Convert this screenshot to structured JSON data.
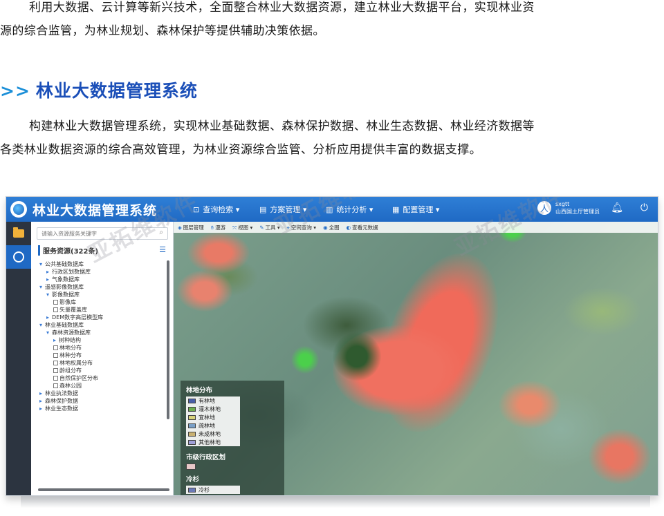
{
  "article": {
    "para1_line1": "利用大数据、云计算等新兴技术，全面整合林业大数据资源，建立林业大数据平台，实现林业资",
    "para1_line2": "源的综合监管，为林业规划、森林保护等提供辅助决策依据。",
    "heading_chevron": ">>",
    "heading": "林业大数据管理系统",
    "para2_line1": "构建林业大数据管理系统，实现林业基础数据、森林保护数据、林业生态数据、林业经济数据等",
    "para2_line2": "各类林业数据资源的综合高效管理，为林业资源综合监管、分析应用提供丰富的数据支撑。"
  },
  "watermark": "亚拓维软件",
  "app": {
    "title": "林业大数据管理系统",
    "menu": [
      {
        "icon": "search-icon",
        "label": "查询检索 ▾"
      },
      {
        "icon": "document-icon",
        "label": "方案管理 ▾"
      },
      {
        "icon": "chart-icon",
        "label": "统计分析 ▾"
      },
      {
        "icon": "settings-icon",
        "label": "配置管理 ▾"
      }
    ],
    "user": {
      "name": "sxgtt",
      "role": "山西国土厅管理员",
      "avatar": "人"
    },
    "bell_icon": "bell-icon",
    "logout_icon": "logout-icon"
  },
  "panel": {
    "search_placeholder": "请输入资源服务关键字",
    "resource_title": "服务资源(322条)",
    "tree": [
      {
        "level": 0,
        "toggle": "▾",
        "check": false,
        "label": "公共基础数据库"
      },
      {
        "level": 1,
        "toggle": "▸",
        "check": false,
        "label": "行政区划数据库"
      },
      {
        "level": 1,
        "toggle": "▸",
        "check": false,
        "label": "气象数据库"
      },
      {
        "level": 0,
        "toggle": "▾",
        "check": false,
        "label": "遥感影像数据库"
      },
      {
        "level": 1,
        "toggle": "▾",
        "check": false,
        "label": "影像数据库"
      },
      {
        "level": 2,
        "toggle": "",
        "check": true,
        "label": "影像库"
      },
      {
        "level": 2,
        "toggle": "",
        "check": true,
        "label": "矢量覆盖库"
      },
      {
        "level": 1,
        "toggle": "▸",
        "check": false,
        "label": "DEM数字高层模型库"
      },
      {
        "level": 0,
        "toggle": "▾",
        "check": false,
        "label": "林业基础数据库"
      },
      {
        "level": 1,
        "toggle": "▾",
        "check": false,
        "label": "森林资源数据库"
      },
      {
        "level": 2,
        "toggle": "▸",
        "check": false,
        "label": "树种结构"
      },
      {
        "level": 2,
        "toggle": "",
        "check": true,
        "label": "林地分布"
      },
      {
        "level": 2,
        "toggle": "",
        "check": true,
        "label": "林种分布"
      },
      {
        "level": 2,
        "toggle": "",
        "check": true,
        "label": "林地权属分布"
      },
      {
        "level": 2,
        "toggle": "",
        "check": true,
        "label": "龄组分布"
      },
      {
        "level": 2,
        "toggle": "",
        "check": true,
        "label": "自然保护区分布"
      },
      {
        "level": 2,
        "toggle": "",
        "check": true,
        "label": "森林公园"
      },
      {
        "level": 0,
        "toggle": "▸",
        "check": false,
        "label": "林业执法数据"
      },
      {
        "level": 0,
        "toggle": "▸",
        "check": false,
        "label": "森林保护数据"
      },
      {
        "level": 0,
        "toggle": "▸",
        "check": false,
        "label": "林业生态数据"
      }
    ]
  },
  "map": {
    "toolbar": [
      {
        "icon": "layers-icon",
        "label": "图层管理"
      },
      {
        "icon": "pan-icon",
        "label": "漫游"
      },
      {
        "icon": "view-icon",
        "label": "视图 ▾"
      },
      {
        "icon": "tools-icon",
        "label": "工具 ▾"
      },
      {
        "icon": "query-icon",
        "label": "空间查询 ▾"
      },
      {
        "icon": "globe-icon",
        "label": "全图"
      },
      {
        "icon": "eye-icon",
        "label": "查看元数据"
      }
    ],
    "legend": {
      "group1_title": "林地分布",
      "items": [
        {
          "label": "有林地",
          "color": "#4a5fa8"
        },
        {
          "label": "灌木林地",
          "color": "#6fae4f"
        },
        {
          "label": "宜林地",
          "color": "#d8d27a"
        },
        {
          "label": "疏林地",
          "color": "#7aa0c8"
        },
        {
          "label": "未成林地",
          "color": "#c8b072"
        },
        {
          "label": "其他林地",
          "color": "#a0a0d8"
        }
      ],
      "group2_title": "市级行政区划",
      "group2_swatch": "#e8c8c8",
      "group3_title": "冷杉",
      "group3_item": "冷杉",
      "group3_color": "#6b7ab8"
    }
  }
}
